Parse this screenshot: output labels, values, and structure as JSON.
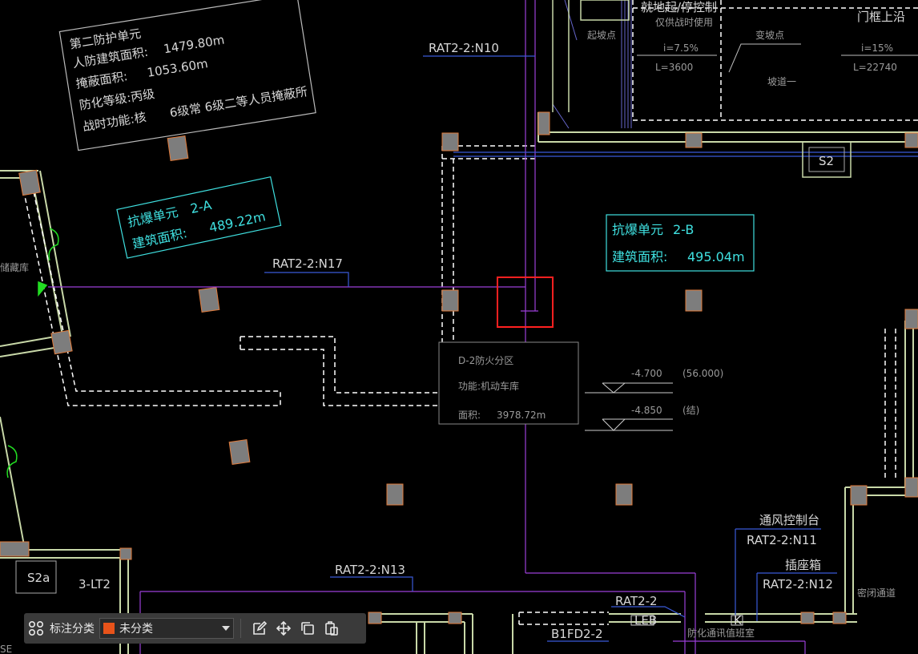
{
  "drawing": {
    "info_box": {
      "title": "第二防护单元",
      "row1_label": "人防建筑面积:",
      "row1_value": "1479.80m",
      "row2_label": "掩蔽面积:",
      "row2_value": "1053.60m",
      "row3_label": "防化等级:丙级",
      "row4_label": "战时功能:核",
      "row4_value": "6级常  6级二等人员掩蔽所"
    },
    "unit_2a": {
      "title": "抗爆单元",
      "code": "2-A",
      "area_label": "建筑面积:",
      "area": "489.22m"
    },
    "unit_2b": {
      "title": "抗爆单元",
      "code": "2-B",
      "area_label": "建筑面积:",
      "area": "495.04m"
    },
    "fire_zone": {
      "name": "D-2防火分区",
      "function": "功能:机动车库",
      "area_label": "面积:",
      "area": "3978.72m"
    },
    "elevations": [
      {
        "value": "-4.700",
        "note": "(56.000)"
      },
      {
        "value": "-4.850",
        "note": "(结)"
      }
    ],
    "tags": {
      "n10": "RAT2-2:N10",
      "n17": "RAT2-2:N17",
      "n13": "RAT2-2:N13",
      "n11": "RAT2-2:N11",
      "n12": "RAT2-2:N12",
      "rat": "RAT2-2",
      "b1fd": "B1FD2-2"
    },
    "labels": {
      "top_mid": "就地起/停控制",
      "top_mid2": "仅供战时使用",
      "start_point": "起坡点",
      "slope_1": "i=7.5%",
      "len_1": "L=3600",
      "change_point": "变坡点",
      "slope_2": "i=15%",
      "len_2": "L=22740",
      "ramp": "坡道一",
      "top_right": "门框上沿",
      "vent_ctrl": "通风控制台",
      "socket_box": "插座箱",
      "closed_passage": "密闭通道",
      "s2": "S2",
      "s2a": "S2a",
      "lt2": "3-LT2",
      "leb": "LEB",
      "k": "K",
      "bottom_label": "防化通讯值班室",
      "left_room": "储藏库",
      "se": "SE"
    }
  },
  "toolbar": {
    "category_label": "标注分类",
    "category_value": "未分类",
    "swatch_color": "#e8531a"
  }
}
